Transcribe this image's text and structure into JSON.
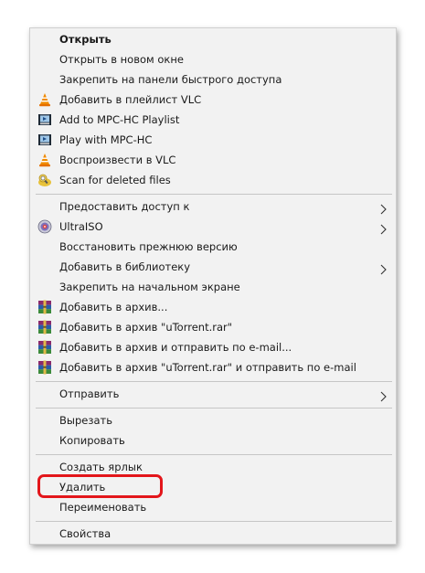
{
  "context_menu": {
    "items": [
      {
        "label": "Открыть"
      },
      {
        "label": "Открыть в новом окне"
      },
      {
        "label": "Закрепить на панели быстрого доступа"
      },
      {
        "label": "Добавить в плейлист VLC",
        "icon": "vlc-icon"
      },
      {
        "label": "Add to MPC-HC Playlist",
        "icon": "mpc-hc-icon"
      },
      {
        "label": "Play with MPC-HC",
        "icon": "mpc-hc-icon"
      },
      {
        "label": "Воспроизвести в VLC",
        "icon": "vlc-icon"
      },
      {
        "label": "Scan for deleted files",
        "icon": "recuva-icon"
      },
      {
        "label": "Предоставить доступ к",
        "has_submenu": true
      },
      {
        "label": "UltraISO",
        "icon": "ultraiso-icon",
        "has_submenu": true
      },
      {
        "label": "Восстановить прежнюю версию"
      },
      {
        "label": "Добавить в библиотеку",
        "has_submenu": true
      },
      {
        "label": "Закрепить на начальном экране"
      },
      {
        "label": "Добавить в архив...",
        "icon": "winrar-icon"
      },
      {
        "label": "Добавить в архив \"uTorrent.rar\"",
        "icon": "winrar-icon"
      },
      {
        "label": "Добавить в архив и отправить по e-mail...",
        "icon": "winrar-icon"
      },
      {
        "label": "Добавить в архив \"uTorrent.rar\" и отправить по e-mail",
        "icon": "winrar-icon"
      },
      {
        "label": "Отправить",
        "has_submenu": true
      },
      {
        "label": "Вырезать"
      },
      {
        "label": "Копировать"
      },
      {
        "label": "Создать ярлык"
      },
      {
        "label": "Удалить",
        "highlighted": true
      },
      {
        "label": "Переименовать"
      },
      {
        "label": "Свойства"
      }
    ]
  },
  "colors": {
    "menu_background": "#f2f2f2",
    "separator": "#c6c6c6",
    "highlight_outline": "#e3161b",
    "text": "#1a1a1a"
  }
}
